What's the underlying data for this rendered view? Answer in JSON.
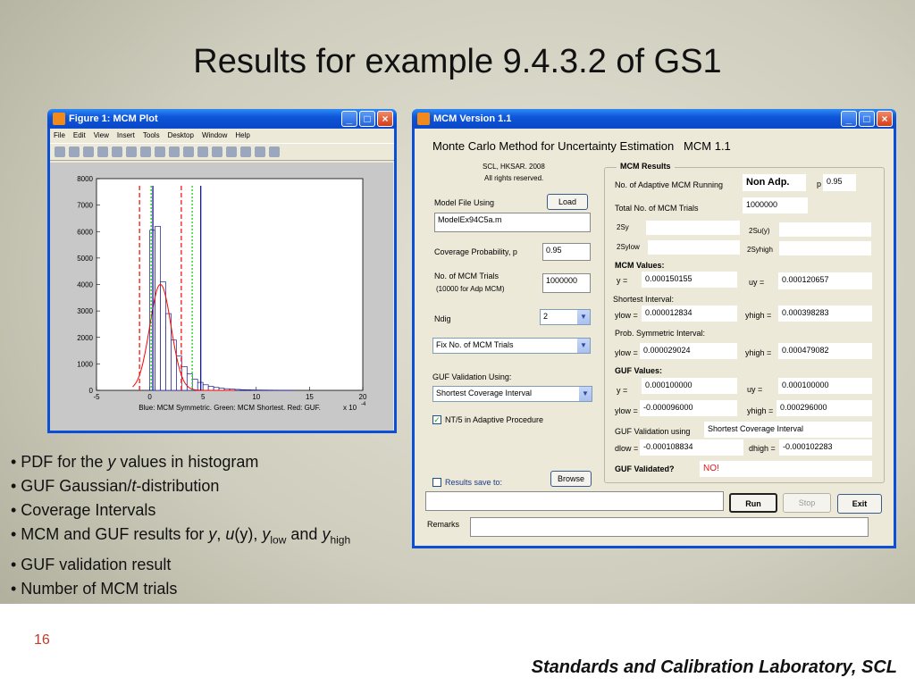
{
  "slide": {
    "title": "Results for example 9.4.3.2 of GS1",
    "bullets": [
      {
        "pre": "• PDF for the ",
        "it": "y",
        "post": " values in histogram"
      },
      {
        "pre": "• GUF Gaussian/",
        "it": "t",
        "post": "-distribution"
      },
      {
        "pre": "• Coverage Intervals",
        "it": "",
        "post": ""
      },
      {
        "pre": "• GUF validation result",
        "it": "",
        "post": ""
      },
      {
        "pre": "• Number of MCM trials",
        "it": "",
        "post": ""
      }
    ],
    "bullet4": {
      "a": "• MCM and GUF results for ",
      "y": "y",
      "comma": ", ",
      "u": "u",
      "uy": "(y), ",
      "y2": "y",
      "low": "low",
      "and": " and ",
      "y3": "y",
      "high": "high"
    },
    "page_number": "16",
    "footer": "Standards and Calibration Laboratory, SCL"
  },
  "figure_window": {
    "title": "Figure 1: MCM Plot",
    "menu": [
      "File",
      "Edit",
      "View",
      "Insert",
      "Tools",
      "Desktop",
      "Window",
      "Help"
    ],
    "xlabel": "Blue: MCM Symmetric. Green: MCM Shortest. Red: GUF.",
    "x_multiplier": "x 10",
    "x_multiplier_exp": "-4"
  },
  "chart_data": {
    "type": "bar",
    "x_ticks": [
      "-5",
      "0",
      "5",
      "10",
      "15",
      "20"
    ],
    "y_ticks": [
      "0",
      "1000",
      "2000",
      "3000",
      "4000",
      "5000",
      "6000",
      "7000",
      "8000"
    ],
    "xlim": [
      -5,
      20
    ],
    "ylim": [
      0,
      8000
    ],
    "bin_width": 0.5,
    "hist_x": [
      0,
      0.5,
      1,
      1.5,
      2,
      2.5,
      3,
      3.5,
      4,
      4.5,
      5,
      5.5,
      6,
      6.5,
      7,
      7.5,
      8,
      8.5,
      9,
      9.5,
      10,
      10.5,
      11,
      11.5,
      12,
      12.5,
      13
    ],
    "hist_y": [
      6050,
      6200,
      4100,
      2900,
      1900,
      1300,
      900,
      620,
      420,
      300,
      210,
      150,
      110,
      80,
      60,
      45,
      35,
      25,
      20,
      15,
      12,
      10,
      8,
      6,
      5,
      4,
      3
    ],
    "gaussian_mean": 1.0,
    "gaussian_sd": 1.0,
    "gaussian_peak": 4000,
    "guf_interval": [
      -0.961,
      2.961
    ],
    "mcm_shortest_interval": [
      0.128,
      3.983
    ],
    "mcm_symmetric_interval": [
      0.29,
      4.79
    ],
    "colors": {
      "mcm_symmetric": "#00008b",
      "mcm_shortest": "#00cc00",
      "guf": "#ff0000",
      "bars": "#1a1a8c"
    }
  },
  "mcm_window": {
    "title": "MCM Version 1.1",
    "heading": "Monte Carlo Method for Uncertainty Estimation   MCM 1.1",
    "copyright1": "SCL, HKSAR. 2008",
    "copyright2": "All rights reserved.",
    "model_file_label": "Model File Using",
    "load_button": "Load",
    "model_file": "ModelEx94C5a.m",
    "coverage_label": "Coverage Probability, p",
    "coverage_value": "0.95",
    "trials_label": "No. of MCM Trials",
    "trials_sub": "(10000 for Adp MCM)",
    "trials_value": "1000000",
    "ndig_label": "Ndig",
    "ndig_value": "2",
    "trials_mode": "Fix No. of MCM Trials",
    "guf_validation_label": "GUF Validation Using:",
    "guf_validation_value": "Shortest Coverage Interval",
    "nt5_label": "NT/5 in Adaptive Procedure",
    "results_save_label": "Results save to:",
    "browse_button": "Browse",
    "run_button": "Run",
    "stop_button": "Stop",
    "exit_button": "Exit",
    "remarks_label": "Remarks",
    "results": {
      "group_title": "MCM Results",
      "adaptive_label": "No. of Adaptive MCM Running",
      "adaptive_value": "Non Adp.",
      "p_label": "p",
      "p_value": "0.95",
      "total_label": "Total No. of MCM Trials",
      "total_value": "1000000",
      "sy_label": "2Sy",
      "suy_label": "2Su(y)",
      "sylow_label": "2Sylow",
      "syhigh_label": "2Syhigh",
      "mcm_values_label": "MCM Values:",
      "y_label": "y =",
      "y_value": "0.000150155",
      "uy_label": "uy =",
      "uy_value": "0.000120657",
      "shortest_label": "Shortest Interval:",
      "ylow_label": "ylow =",
      "ylow_value": "0.000012834",
      "yhigh_label": "yhigh =",
      "yhigh_value": "0.000398283",
      "probsym_label": "Prob. Symmetric Interval:",
      "ylow2_label": "ylow =",
      "ylow2_value": "0.000029024",
      "yhigh2_label": "yhigh =",
      "yhigh2_value": "0.000479082",
      "guf_values_label": "GUF Values:",
      "gy_label": "y =",
      "gy_value": "0.000100000",
      "guy_label": "uy =",
      "guy_value": "0.000100000",
      "gylow_label": "ylow =",
      "gylow_value": "-0.000096000",
      "gyhigh_label": "yhigh =",
      "gyhigh_value": "0.000296000",
      "guf_using_label": "GUF Validation using",
      "guf_using_value": "Shortest Coverage Interval",
      "dlow_label": "dlow =",
      "dlow_value": "-0.000108834",
      "dhigh_label": "dhigh =",
      "dhigh_value": "-0.000102283",
      "validated_label": "GUF Validated?",
      "validated_value": "NO!"
    }
  }
}
